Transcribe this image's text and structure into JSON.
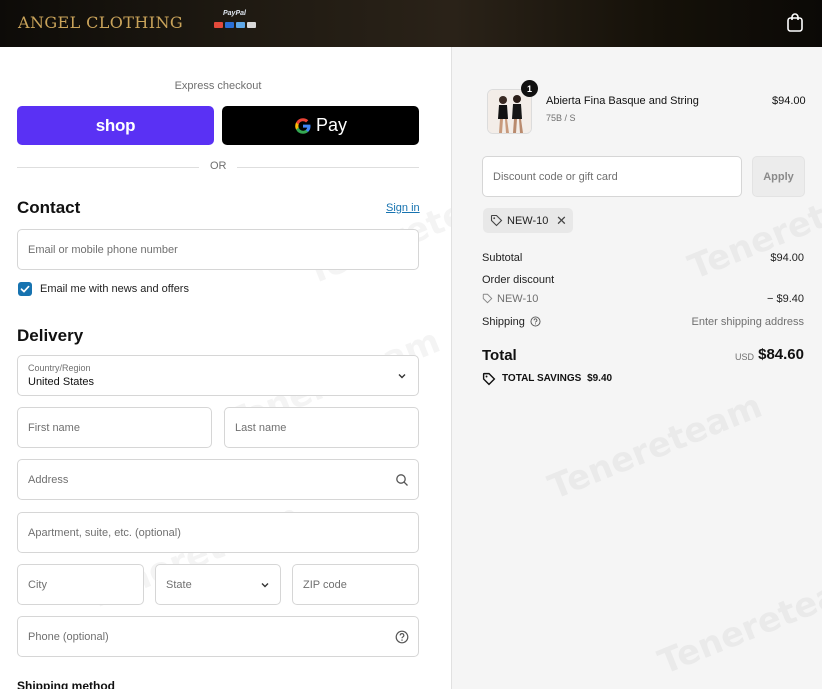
{
  "header": {
    "brand": "ANGEL CLOTHING",
    "paypal_label": "PayPal"
  },
  "express": {
    "label": "Express checkout",
    "shop_label": "shop",
    "gpay_label": "Pay",
    "or_label": "OR"
  },
  "contact": {
    "title": "Contact",
    "signin_label": "Sign in",
    "email_placeholder": "Email or mobile phone number",
    "newsletter_label": "Email me with news and offers",
    "newsletter_checked": true
  },
  "delivery": {
    "title": "Delivery",
    "country_label": "Country/Region",
    "country_value": "United States",
    "first_name_placeholder": "First name",
    "last_name_placeholder": "Last name",
    "address_placeholder": "Address",
    "apartment_placeholder": "Apartment, suite, etc. (optional)",
    "city_placeholder": "City",
    "state_placeholder": "State",
    "zip_placeholder": "ZIP code",
    "phone_placeholder": "Phone (optional)"
  },
  "shipping_method": {
    "title": "Shipping method"
  },
  "order": {
    "item": {
      "quantity": "1",
      "name": "Abierta Fina Basque and String",
      "variant": "75B / S",
      "price": "$94.00"
    },
    "discount_placeholder": "Discount code or gift card",
    "apply_label": "Apply",
    "applied_code": "NEW-10",
    "subtotal_label": "Subtotal",
    "subtotal_value": "$94.00",
    "order_discount_label": "Order discount",
    "discount_code": "NEW-10",
    "discount_value": "− $9.40",
    "shipping_label": "Shipping",
    "shipping_value": "Enter shipping address",
    "total_label": "Total",
    "currency": "USD",
    "total_value": "$84.60",
    "savings_label": "TOTAL SAVINGS",
    "savings_value": "$9.40"
  },
  "watermark": "Tenereteam",
  "colors": {
    "shop_purple": "#5a31f4",
    "link_blue": "#1773b0",
    "brand_gold": "#c9a35a"
  }
}
